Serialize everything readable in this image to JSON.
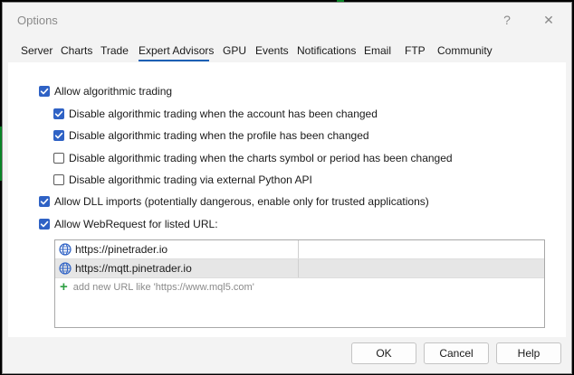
{
  "window": {
    "title": "Options",
    "help_glyph": "?",
    "close_glyph": "✕"
  },
  "tabs": [
    {
      "label": "Server"
    },
    {
      "label": "Charts"
    },
    {
      "label": "Trade"
    },
    {
      "label": "Expert Advisors",
      "active": true
    },
    {
      "label": "GPU"
    },
    {
      "label": "Events"
    },
    {
      "label": "Notifications"
    },
    {
      "label": "Email"
    },
    {
      "label": "FTP"
    },
    {
      "label": "Community"
    }
  ],
  "options": [
    {
      "label": "Allow algorithmic trading",
      "checked": true
    },
    {
      "label": "Disable algorithmic trading when the account has been changed",
      "checked": true
    },
    {
      "label": "Disable algorithmic trading when the profile has been changed",
      "checked": true
    },
    {
      "label": "Disable algorithmic trading when the charts symbol or period has been changed",
      "checked": false
    },
    {
      "label": "Disable algorithmic trading via external Python API",
      "checked": false
    },
    {
      "label": "Allow DLL imports (potentially dangerous, enable only for trusted applications)",
      "checked": true
    },
    {
      "label": "Allow WebRequest for listed URL:",
      "checked": true
    }
  ],
  "urls": [
    {
      "url": "https://pinetrader.io"
    },
    {
      "url": "https://mqtt.pinetrader.io"
    }
  ],
  "add_url": {
    "icon": "plus-icon",
    "placeholder": "add new URL like 'https://www.mql5.com'"
  },
  "buttons": {
    "ok": "OK",
    "cancel": "Cancel",
    "help": "Help"
  },
  "colors": {
    "accent": "#2f62c5",
    "tab_underline": "#1a5fb4",
    "selected_row": "#e6e6e6",
    "plus": "#2ea043"
  }
}
